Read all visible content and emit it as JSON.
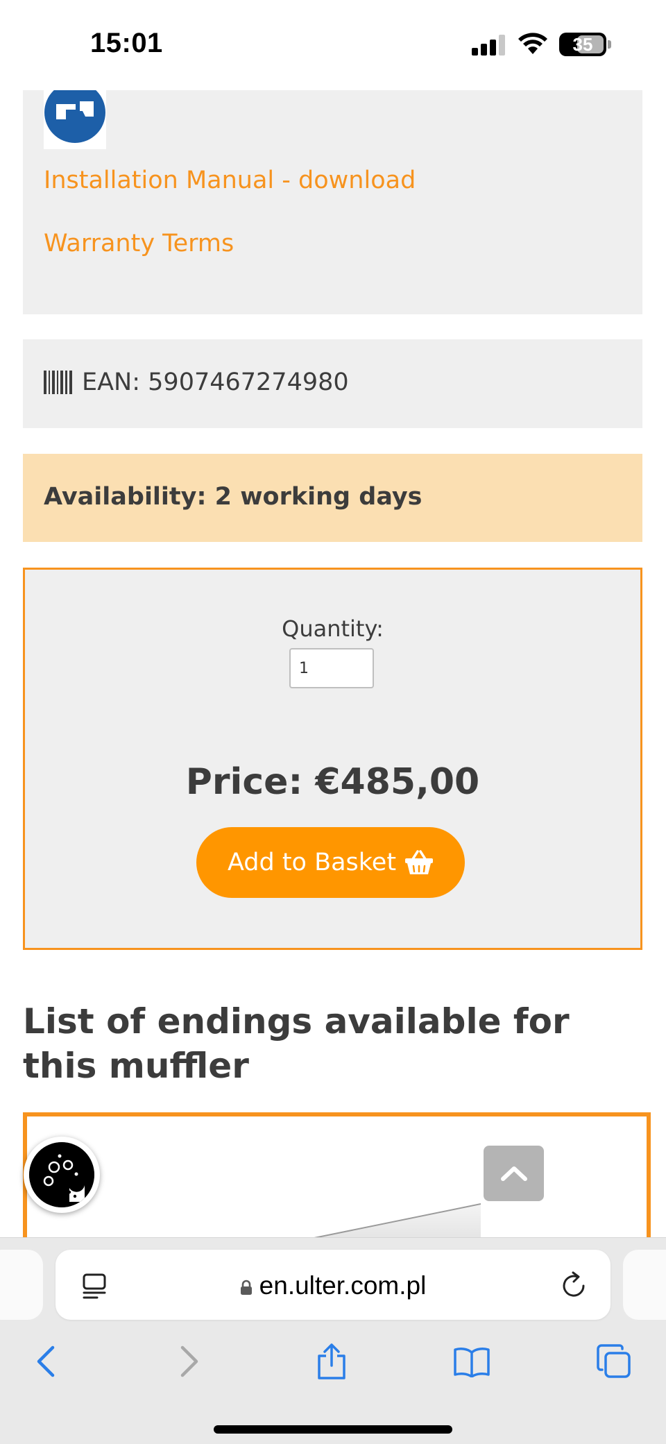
{
  "status_bar": {
    "time": "15:01",
    "battery": "35"
  },
  "documents": {
    "installation_link": "Installation Manual - download",
    "warranty_link": "Warranty Terms"
  },
  "ean": {
    "text": "EAN: 5907467274980"
  },
  "availability": {
    "text": "Availability: 2 working days"
  },
  "purchase": {
    "quantity_label": "Quantity:",
    "quantity_value": "1",
    "price": "Price: €485,00",
    "add_to_basket_label": "Add to Basket"
  },
  "endings": {
    "title": "List of endings available for this muffler"
  },
  "browser": {
    "url": "en.ulter.com.pl"
  },
  "colors": {
    "accent_orange": "#f7931e",
    "button_orange": "#ff9600",
    "availability_bg": "#fbdfb2",
    "panel_bg": "#efefef"
  },
  "icons": [
    "installation-icon",
    "barcode-icon",
    "basket-icon",
    "cookie-icon",
    "chevron-up-icon",
    "reader-icon",
    "lock-icon",
    "reload-icon",
    "back-icon",
    "forward-icon",
    "share-icon",
    "bookmarks-icon",
    "tabs-icon"
  ]
}
